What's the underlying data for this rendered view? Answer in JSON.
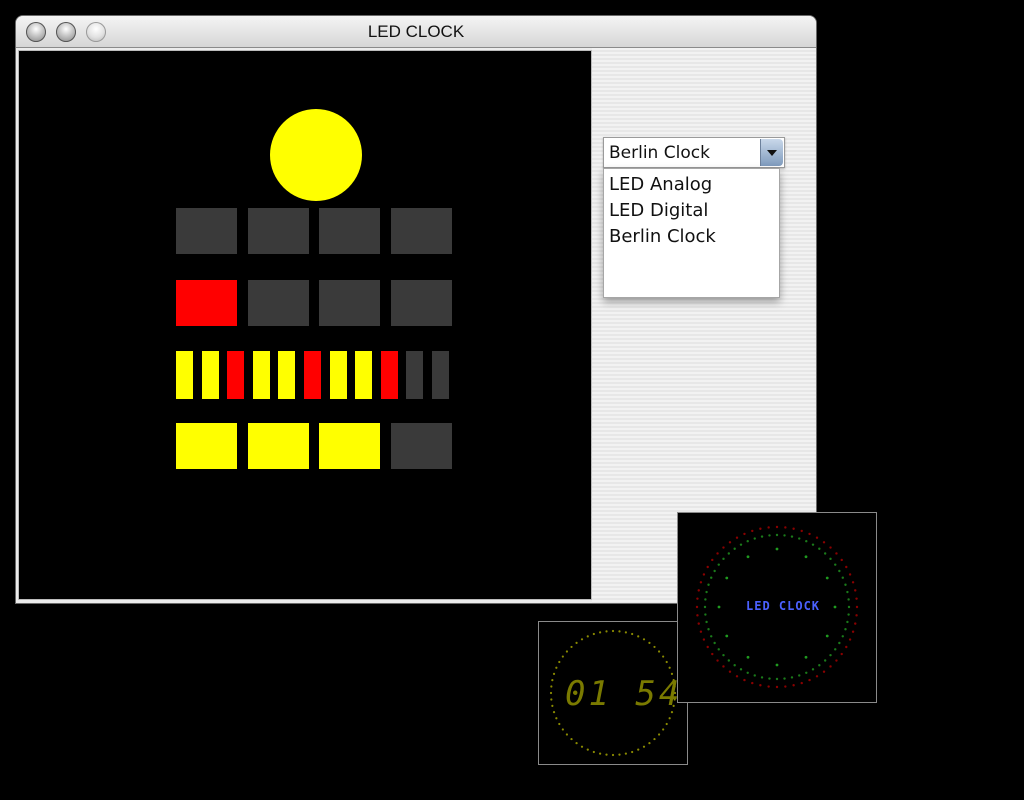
{
  "window": {
    "title": "LED CLOCK"
  },
  "traffic_lights": [
    "close-button",
    "minimize-button",
    "zoom-button"
  ],
  "berlin_clock": {
    "seconds_lamp_on": true,
    "five_hour_row": [
      false,
      false,
      false,
      false
    ],
    "one_hour_row": [
      true,
      false,
      false,
      false
    ],
    "five_minute_row": [
      "yellow",
      "yellow",
      "red",
      "yellow",
      "yellow",
      "red",
      "yellow",
      "yellow",
      "red",
      "off",
      "off"
    ],
    "one_minute_row": [
      true,
      true,
      true,
      false
    ],
    "colors": {
      "on_yellow": "#ffff00",
      "on_red": "#ff0000",
      "off": "#3a3a3a"
    }
  },
  "clock_selector": {
    "selected": "Berlin Clock",
    "options": [
      "LED Analog",
      "LED Digital",
      "Berlin Clock"
    ]
  },
  "digital_preview": {
    "time_text": "01 54"
  },
  "analog_preview": {
    "label": "LED CLOCK"
  }
}
